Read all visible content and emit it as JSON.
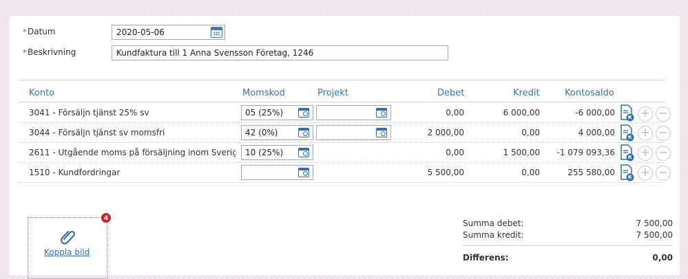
{
  "form": {
    "required_mark": "*",
    "date_label": "Datum",
    "date_value": "2020-05-06",
    "description_label": "Beskrivning",
    "description_value": "Kundfaktura till 1 Anna Svensson Företag, 1246"
  },
  "table": {
    "headers": {
      "konto": "Konto",
      "momskod": "Momskod",
      "projekt": "Projekt",
      "debet": "Debet",
      "kredit": "Kredit",
      "kontosaldo": "Kontosaldo"
    },
    "rows": [
      {
        "konto": "3041 - Försäljn tjänst 25% sv",
        "momskod": "05 (25%)",
        "projekt": "",
        "debet": "0,00",
        "kredit": "6 000,00",
        "kontosaldo": "-6 000,00"
      },
      {
        "konto": "3044 - Försäljn tjänst sv momsfri",
        "momskod": "42 (0%)",
        "projekt": "",
        "debet": "2 000,00",
        "kredit": "0,00",
        "kontosaldo": "4 000,00"
      },
      {
        "konto": "2611 - Utgående moms på försäljning inom Sverig...",
        "momskod": "10 (25%)",
        "debet": "0,00",
        "kredit": "1 500,00",
        "kontosaldo": "-1 079 093,36"
      },
      {
        "konto": "1510 - Kundfordringar",
        "momskod": "",
        "debet": "5 500,00",
        "kredit": "0,00",
        "kontosaldo": "255 580,00"
      }
    ],
    "row_buttons": {
      "add": "+",
      "remove": "−"
    }
  },
  "attachment": {
    "badge_count": "4",
    "link_label": "Koppla bild"
  },
  "summary": {
    "debet_label": "Summa debet:",
    "debet_value": "7 500,00",
    "kredit_label": "Summa kredit:",
    "kredit_value": "7 500,00",
    "diff_label": "Differens:",
    "diff_value": "0,00"
  },
  "colors": {
    "header_blue": "#3a76ad",
    "icon_blue": "#2e6fb7",
    "required_red": "#c0392b",
    "badge_red": "#c8242a"
  }
}
